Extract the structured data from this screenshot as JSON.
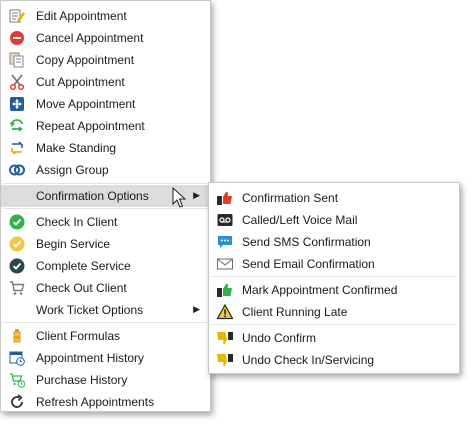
{
  "main_menu": {
    "items": [
      {
        "label": "Edit Appointment",
        "icon": "edit-icon"
      },
      {
        "label": "Cancel Appointment",
        "icon": "cancel-icon"
      },
      {
        "label": "Copy Appointment",
        "icon": "copy-icon"
      },
      {
        "label": "Cut Appointment",
        "icon": "scissors-icon"
      },
      {
        "label": "Move Appointment",
        "icon": "move-icon"
      },
      {
        "label": "Repeat Appointment",
        "icon": "repeat-icon"
      },
      {
        "label": "Make Standing",
        "icon": "standing-icon"
      },
      {
        "label": "Assign Group",
        "icon": "group-icon"
      },
      {
        "label": "Confirmation Options",
        "icon": "none",
        "submenu": true,
        "highlighted": true
      },
      {
        "label": "Check In Client",
        "icon": "check-in-icon"
      },
      {
        "label": "Begin Service",
        "icon": "begin-service-icon"
      },
      {
        "label": "Complete Service",
        "icon": "complete-service-icon"
      },
      {
        "label": "Check Out Client",
        "icon": "cart-icon"
      },
      {
        "label": "Work Ticket Options",
        "icon": "none",
        "submenu": true
      },
      {
        "label": "Client Formulas",
        "icon": "formula-bottle-icon"
      },
      {
        "label": "Appointment History",
        "icon": "calendar-history-icon"
      },
      {
        "label": "Purchase History",
        "icon": "cart-history-icon"
      },
      {
        "label": "Refresh Appointments",
        "icon": "refresh-icon"
      }
    ]
  },
  "submenu": {
    "items": [
      {
        "label": "Confirmation Sent",
        "icon": "confirmation-sent-icon"
      },
      {
        "label": "Called/Left Voice Mail",
        "icon": "voicemail-icon"
      },
      {
        "label": "Send SMS Confirmation",
        "icon": "sms-icon"
      },
      {
        "label": "Send Email Confirmation",
        "icon": "email-icon"
      },
      {
        "label": "Mark Appointment Confirmed",
        "icon": "confirmed-icon"
      },
      {
        "label": "Client Running Late",
        "icon": "warning-icon"
      },
      {
        "label": "Undo Confirm",
        "icon": "undo-confirm-icon"
      },
      {
        "label": "Undo Check In/Servicing",
        "icon": "undo-checkin-icon"
      }
    ]
  },
  "colors": {
    "highlight": "#dcdcdc",
    "check_green": "#2fb34a",
    "begin_yellow": "#f6c343",
    "complete_dark": "#2a4650",
    "cancel_red": "#e03b2f",
    "move_blue": "#1f5e9b",
    "thumb_yellow": "#e6b800"
  }
}
